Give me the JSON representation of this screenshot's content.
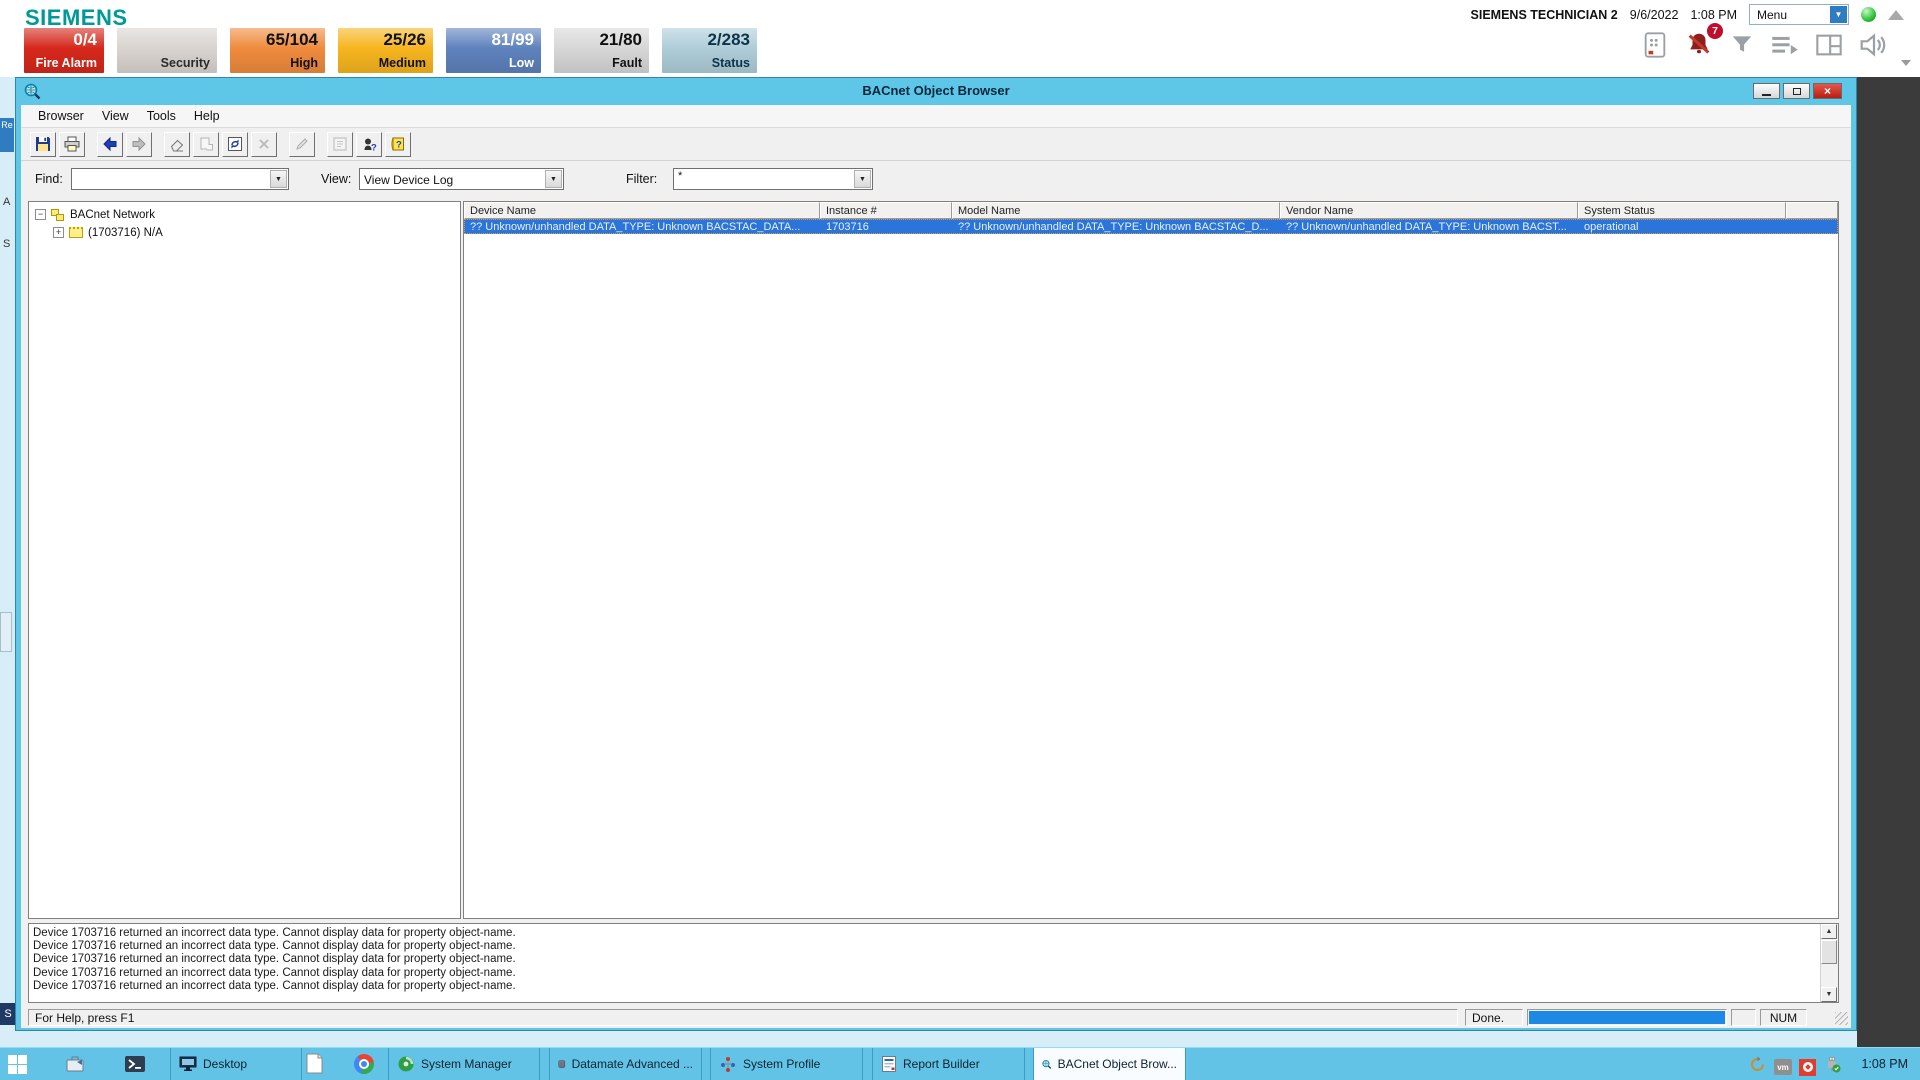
{
  "header": {
    "brand": "SIEMENS",
    "user": "SIEMENS TECHNICIAN 2",
    "date": "9/6/2022",
    "time": "1:08 PM",
    "menu_label": "Menu",
    "notification_badge": "7",
    "alarm_buttons": [
      {
        "value": "0/4",
        "label": "Fire Alarm",
        "bg": "#d5281b",
        "fg": "#ffffff"
      },
      {
        "value": "",
        "label": "Security",
        "bg": "#d9d4d0",
        "fg": "#2b2b2b"
      },
      {
        "value": "65/104",
        "label": "High",
        "bg": "#ef8b3d",
        "fg": "#111111"
      },
      {
        "value": "25/26",
        "label": "Medium",
        "bg": "#f6b51f",
        "fg": "#111111"
      },
      {
        "value": "81/99",
        "label": "Low",
        "bg": "#5e82bd",
        "fg": "#ffffff"
      },
      {
        "value": "21/80",
        "label": "Fault",
        "bg": "#d7d7d7",
        "fg": "#111111"
      },
      {
        "value": "2/283",
        "label": "Status",
        "bg": "#aecdd9",
        "fg": "#0d3349"
      }
    ],
    "icon_names": [
      "badge-reader-icon",
      "alarm-mute-icon",
      "filter-icon",
      "event-list-icon",
      "layout-icon",
      "speaker-icon"
    ]
  },
  "edge": {
    "tab_top": "Re",
    "letter_a": "A",
    "letter_s": "S",
    "tab_bottom": "S"
  },
  "window": {
    "title": "BACnet Object Browser",
    "menu_items": [
      "Browser",
      "View",
      "Tools",
      "Help"
    ],
    "toolbar_icon_names": [
      "save",
      "print",
      "back",
      "forward",
      "erase",
      "copy-page",
      "refresh",
      "delete",
      "edit",
      "properties",
      "context-help",
      "help"
    ],
    "find_label": "Find:",
    "find_value": "",
    "view_label": "View:",
    "view_value": "View Device Log",
    "filter_label": "Filter:",
    "filter_value": "*",
    "tree": {
      "root_label": "BACnet Network",
      "child_label": "(1703716) N/A"
    },
    "table": {
      "columns": [
        "Device Name",
        "Instance #",
        "Model Name",
        "Vendor Name",
        "System Status"
      ],
      "selected_row": {
        "device_name": "?? Unknown/unhandled DATA_TYPE: Unknown BACSTAC_DATA...",
        "instance": "1703716",
        "model_name": "?? Unknown/unhandled DATA_TYPE: Unknown BACSTAC_D...",
        "vendor_name": "?? Unknown/unhandled DATA_TYPE: Unknown BACST...",
        "system_status": "operational"
      }
    },
    "log_lines": [
      "Device 1703716 returned an incorrect data type.  Cannot display data for property object-name.",
      "Device 1703716 returned an incorrect data type.  Cannot display data for property object-name.",
      "Device 1703716 returned an incorrect data type.  Cannot display data for property object-name.",
      "Device 1703716 returned an incorrect data type.  Cannot display data for property object-name.",
      "Device 1703716 returned an incorrect data type.  Cannot display data for property object-name."
    ],
    "status_bar": {
      "message": "For Help, press F1",
      "done": "Done.",
      "num": "NUM"
    }
  },
  "taskbar": {
    "buttons": [
      {
        "label": "Desktop"
      },
      {
        "label": "System Manager"
      },
      {
        "label": "Datamate Advanced ..."
      },
      {
        "label": "System Profile"
      },
      {
        "label": "Report Builder"
      },
      {
        "label": "BACnet Object Brow..."
      }
    ],
    "vm_label": "vm",
    "tray_icon_names": [
      "sync-icon",
      "vm-icon",
      "recording-icon",
      "usb-icon"
    ],
    "tray_time": "1:08 PM"
  },
  "accent_colors": {
    "titlebar": "#5ec7e8",
    "taskbar": "#63c3e6",
    "selection": "#2b74d9",
    "progress": "#1e88e5",
    "brand": "#009999"
  }
}
